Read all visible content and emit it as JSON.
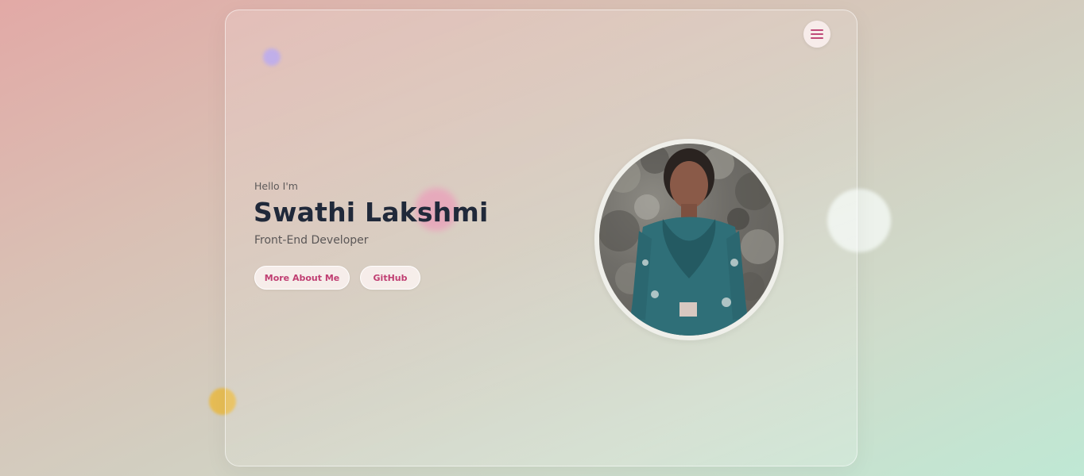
{
  "hero": {
    "greeting": "Hello I'm",
    "name": "Swathi Lakshmi",
    "role": "Front-End Developer",
    "buttons": {
      "about_label": "More About Me",
      "github_label": "GitHub"
    }
  },
  "nav": {
    "menu_icon": "hamburger-menu-icon"
  },
  "profile": {
    "photo_alt": "Profile photo"
  },
  "colors": {
    "accent": "#c03e72",
    "heading": "#20293a",
    "text": "#5a5656"
  }
}
